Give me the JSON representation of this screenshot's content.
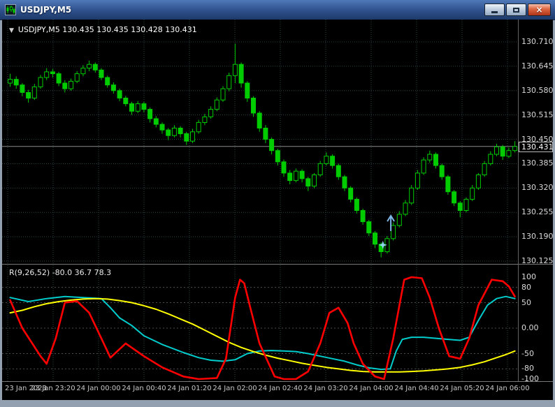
{
  "window": {
    "title": "USDJPY,M5",
    "controls": {
      "close_glyph": "×"
    }
  },
  "chart": {
    "collapse_glyph": "▼",
    "header_text": "USDJPY,M5 130.435 130.435 130.428 130.431",
    "current_price_label": "130.431"
  },
  "chart_data": {
    "type": "candlestick",
    "symbol": "USDJPY",
    "timeframe": "M5",
    "current_price": 130.431,
    "colors": {
      "candle": "#00CC00",
      "background": "#000000",
      "grid": "#2B4545",
      "price_line": "#8A8A8A"
    },
    "price_axis": {
      "min": 130.125,
      "max": 130.71,
      "ticks": [
        130.71,
        130.645,
        130.58,
        130.515,
        130.45,
        130.385,
        130.32,
        130.255,
        130.19,
        130.125
      ]
    },
    "time_labels": [
      "23 Jan 2023",
      "23 Jan 23:20",
      "24 Jan 00:00",
      "24 Jan 00:40",
      "24 Jan 01:20",
      "24 Jan 02:00",
      "24 Jan 02:40",
      "24 Jan 03:20",
      "24 Jan 04:00",
      "24 Jan 04:40",
      "24 Jan 05:20",
      "24 Jan 06:00"
    ],
    "candles": [
      [
        130.6,
        130.625,
        130.59,
        130.61
      ],
      [
        130.61,
        130.618,
        130.585,
        130.595
      ],
      [
        130.595,
        130.6,
        130.565,
        130.575
      ],
      [
        130.575,
        130.582,
        130.548,
        130.56
      ],
      [
        130.56,
        130.598,
        130.555,
        130.59
      ],
      [
        130.59,
        130.622,
        130.585,
        130.615
      ],
      [
        130.615,
        130.64,
        130.608,
        130.63
      ],
      [
        130.63,
        130.638,
        130.615,
        130.625
      ],
      [
        130.625,
        130.63,
        130.592,
        130.6
      ],
      [
        130.6,
        130.608,
        130.575,
        130.585
      ],
      [
        130.585,
        130.612,
        130.58,
        130.605
      ],
      [
        130.605,
        130.632,
        130.6,
        130.625
      ],
      [
        130.625,
        130.648,
        130.618,
        130.64
      ],
      [
        130.64,
        130.66,
        130.632,
        130.65
      ],
      [
        130.65,
        130.655,
        130.628,
        130.635
      ],
      [
        130.635,
        130.64,
        130.608,
        130.615
      ],
      [
        130.615,
        130.62,
        130.588,
        130.595
      ],
      [
        130.595,
        130.602,
        130.572,
        130.58
      ],
      [
        130.58,
        130.585,
        130.552,
        130.56
      ],
      [
        130.56,
        130.566,
        130.538,
        130.545
      ],
      [
        130.545,
        130.55,
        130.515,
        130.525
      ],
      [
        130.525,
        130.552,
        130.52,
        130.545
      ],
      [
        130.545,
        130.55,
        130.522,
        130.53
      ],
      [
        130.53,
        130.535,
        130.495,
        130.505
      ],
      [
        130.505,
        130.512,
        130.482,
        130.49
      ],
      [
        130.49,
        130.495,
        130.465,
        130.475
      ],
      [
        130.475,
        130.48,
        130.448,
        130.46
      ],
      [
        130.46,
        130.488,
        130.455,
        130.48
      ],
      [
        130.48,
        130.485,
        130.455,
        130.465
      ],
      [
        130.465,
        130.47,
        130.435,
        130.445
      ],
      [
        130.445,
        130.478,
        130.44,
        130.47
      ],
      [
        130.47,
        130.502,
        130.465,
        130.495
      ],
      [
        130.495,
        130.518,
        130.488,
        130.51
      ],
      [
        130.51,
        130.538,
        130.505,
        130.53
      ],
      [
        130.53,
        130.562,
        130.525,
        130.555
      ],
      [
        130.555,
        130.592,
        130.55,
        130.585
      ],
      [
        130.585,
        130.628,
        130.578,
        130.62
      ],
      [
        130.62,
        130.705,
        130.6,
        130.65
      ],
      [
        130.65,
        130.655,
        130.588,
        130.6
      ],
      [
        130.6,
        130.605,
        130.55,
        130.56
      ],
      [
        130.56,
        130.565,
        130.51,
        130.52
      ],
      [
        130.52,
        130.525,
        130.47,
        130.48
      ],
      [
        130.48,
        130.488,
        130.44,
        130.45
      ],
      [
        130.45,
        130.455,
        130.41,
        130.42
      ],
      [
        130.42,
        130.425,
        130.38,
        130.39
      ],
      [
        130.39,
        130.396,
        130.35,
        130.36
      ],
      [
        130.36,
        130.368,
        130.33,
        130.34
      ],
      [
        130.34,
        130.372,
        130.335,
        130.365
      ],
      [
        130.365,
        130.37,
        130.335,
        130.345
      ],
      [
        130.345,
        130.35,
        130.312,
        130.325
      ],
      [
        130.325,
        130.36,
        130.32,
        130.355
      ],
      [
        130.355,
        130.392,
        130.35,
        130.385
      ],
      [
        130.385,
        130.415,
        130.38,
        130.405
      ],
      [
        130.405,
        130.41,
        130.372,
        130.38
      ],
      [
        130.38,
        130.385,
        130.342,
        130.35
      ],
      [
        130.35,
        130.355,
        130.312,
        130.32
      ],
      [
        130.32,
        130.325,
        130.282,
        130.29
      ],
      [
        130.29,
        130.295,
        130.252,
        130.26
      ],
      [
        130.26,
        130.265,
        130.222,
        130.23
      ],
      [
        130.23,
        130.235,
        130.192,
        130.2
      ],
      [
        130.2,
        130.205,
        130.16,
        130.17
      ],
      [
        130.17,
        130.175,
        130.135,
        130.15
      ],
      [
        130.15,
        130.192,
        130.145,
        130.185
      ],
      [
        130.185,
        130.228,
        130.18,
        130.22
      ],
      [
        130.22,
        130.258,
        130.215,
        130.25
      ],
      [
        130.25,
        130.288,
        130.245,
        130.28
      ],
      [
        130.28,
        130.328,
        130.275,
        130.32
      ],
      [
        130.32,
        130.368,
        130.315,
        130.36
      ],
      [
        130.36,
        130.402,
        130.355,
        130.395
      ],
      [
        130.395,
        130.42,
        130.388,
        130.41
      ],
      [
        130.41,
        130.415,
        130.372,
        130.38
      ],
      [
        130.38,
        130.385,
        130.342,
        130.35
      ],
      [
        130.35,
        130.355,
        130.302,
        130.31
      ],
      [
        130.31,
        130.315,
        130.272,
        130.28
      ],
      [
        130.28,
        130.285,
        130.242,
        130.26
      ],
      [
        130.26,
        130.295,
        130.255,
        130.29
      ],
      [
        130.29,
        130.328,
        130.285,
        130.32
      ],
      [
        130.32,
        130.36,
        130.315,
        130.355
      ],
      [
        130.355,
        130.392,
        130.35,
        130.385
      ],
      [
        130.385,
        130.418,
        130.38,
        130.41
      ],
      [
        130.41,
        130.438,
        130.405,
        130.43
      ],
      [
        130.43,
        130.435,
        130.395,
        130.405
      ],
      [
        130.405,
        130.428,
        130.4,
        130.42
      ],
      [
        130.42,
        130.445,
        130.415,
        130.431
      ]
    ],
    "markers": [
      {
        "type": "star",
        "index": 61.3,
        "price": 130.168,
        "color": "#8FD8F0"
      },
      {
        "type": "up-arrow",
        "index": 62.6,
        "price": 130.205,
        "color": "#7EB6E8"
      }
    ],
    "indicator": {
      "name": "R(9,26,52)",
      "label": "R(9,26,52) -80.0 36.7 78.3",
      "range": [
        -100,
        100
      ],
      "ticks": [
        {
          "v": 100,
          "label": "100"
        },
        {
          "v": 80,
          "label": "80"
        },
        {
          "v": 50,
          "label": "50"
        },
        {
          "v": 0,
          "label": "0.00"
        },
        {
          "v": -50,
          "label": "-50"
        },
        {
          "v": -80,
          "label": "-80"
        },
        {
          "v": -100,
          "label": "-100"
        }
      ],
      "levels": [
        80,
        50,
        0,
        -50,
        -80
      ],
      "series": [
        {
          "name": "signal-cyan",
          "color": "#00CCCC",
          "width": 2,
          "points": [
            [
              0,
              60
            ],
            [
              3,
              52
            ],
            [
              6,
              58
            ],
            [
              9,
              62
            ],
            [
              12,
              60
            ],
            [
              15,
              58
            ],
            [
              16.5,
              40
            ],
            [
              18,
              20
            ],
            [
              20,
              5
            ],
            [
              22,
              -15
            ],
            [
              25,
              -32
            ],
            [
              28.5,
              -48
            ],
            [
              31,
              -58
            ],
            [
              33,
              -63
            ],
            [
              35,
              -65
            ],
            [
              37,
              -62
            ],
            [
              39,
              -50
            ],
            [
              41,
              -45
            ],
            [
              43,
              -44
            ],
            [
              45,
              -45
            ],
            [
              47,
              -46
            ],
            [
              49,
              -50
            ],
            [
              51,
              -55
            ],
            [
              53,
              -60
            ],
            [
              55,
              -65
            ],
            [
              57,
              -72
            ],
            [
              59,
              -78
            ],
            [
              61,
              -81
            ],
            [
              62.5,
              -80
            ],
            [
              63.5,
              -45
            ],
            [
              64.5,
              -22
            ],
            [
              66,
              -18
            ],
            [
              68,
              -18
            ],
            [
              70,
              -20
            ],
            [
              72,
              -22
            ],
            [
              74,
              -24
            ],
            [
              75.5,
              -18
            ],
            [
              77,
              15
            ],
            [
              78.5,
              45
            ],
            [
              80,
              58
            ],
            [
              81.5,
              62
            ],
            [
              83,
              58
            ]
          ]
        },
        {
          "name": "slow-yellow",
          "color": "#FFFF00",
          "width": 2,
          "points": [
            [
              0,
              30
            ],
            [
              2,
              35
            ],
            [
              4,
              42
            ],
            [
              6,
              48
            ],
            [
              8,
              52
            ],
            [
              10,
              55
            ],
            [
              12,
              57
            ],
            [
              14,
              58
            ],
            [
              16,
              57
            ],
            [
              18,
              54
            ],
            [
              20,
              50
            ],
            [
              22,
              44
            ],
            [
              24,
              37
            ],
            [
              26,
              28
            ],
            [
              28,
              18
            ],
            [
              30,
              8
            ],
            [
              32,
              -4
            ],
            [
              34,
              -16
            ],
            [
              36,
              -28
            ],
            [
              38,
              -38
            ],
            [
              40,
              -46
            ],
            [
              42,
              -53
            ],
            [
              44,
              -59
            ],
            [
              46,
              -64
            ],
            [
              48,
              -69
            ],
            [
              50,
              -73
            ],
            [
              52,
              -77
            ],
            [
              54,
              -80
            ],
            [
              56,
              -83
            ],
            [
              58,
              -85
            ],
            [
              60,
              -86
            ],
            [
              62,
              -86
            ],
            [
              64,
              -86
            ],
            [
              66,
              -85
            ],
            [
              68,
              -84
            ],
            [
              70,
              -82
            ],
            [
              72,
              -80
            ],
            [
              74,
              -77
            ],
            [
              76,
              -72
            ],
            [
              78,
              -66
            ],
            [
              80,
              -58
            ],
            [
              81.5,
              -52
            ],
            [
              83,
              -45
            ]
          ]
        },
        {
          "name": "fast-red",
          "color": "#FF0000",
          "width": 2.6,
          "points": [
            [
              0,
              55
            ],
            [
              2,
              0
            ],
            [
              5,
              -55
            ],
            [
              6,
              -70
            ],
            [
              7.5,
              -20
            ],
            [
              9,
              50
            ],
            [
              11,
              53
            ],
            [
              13,
              30
            ],
            [
              14,
              5
            ],
            [
              16.5,
              -58
            ],
            [
              19,
              -30
            ],
            [
              22,
              -55
            ],
            [
              25,
              -77
            ],
            [
              28.5,
              -95
            ],
            [
              31,
              -100
            ],
            [
              34,
              -98
            ],
            [
              35.5,
              -60
            ],
            [
              37,
              60
            ],
            [
              37.8,
              95
            ],
            [
              38.5,
              88
            ],
            [
              39.5,
              40
            ],
            [
              41,
              -30
            ],
            [
              43.5,
              -95
            ],
            [
              45,
              -100
            ],
            [
              47,
              -100
            ],
            [
              49,
              -85
            ],
            [
              51,
              -30
            ],
            [
              52.5,
              30
            ],
            [
              54,
              40
            ],
            [
              55.5,
              10
            ],
            [
              56.5,
              -30
            ],
            [
              58,
              -70
            ],
            [
              60,
              -95
            ],
            [
              61.5,
              -100
            ],
            [
              63,
              -20
            ],
            [
              64.8,
              95
            ],
            [
              66,
              100
            ],
            [
              67.7,
              98
            ],
            [
              69,
              60
            ],
            [
              70.5,
              0
            ],
            [
              72.2,
              -55
            ],
            [
              74,
              -60
            ],
            [
              75.5,
              -20
            ],
            [
              77,
              45
            ],
            [
              79.2,
              95
            ],
            [
              81,
              92
            ],
            [
              82,
              82
            ],
            [
              83,
              62
            ]
          ]
        }
      ]
    }
  }
}
